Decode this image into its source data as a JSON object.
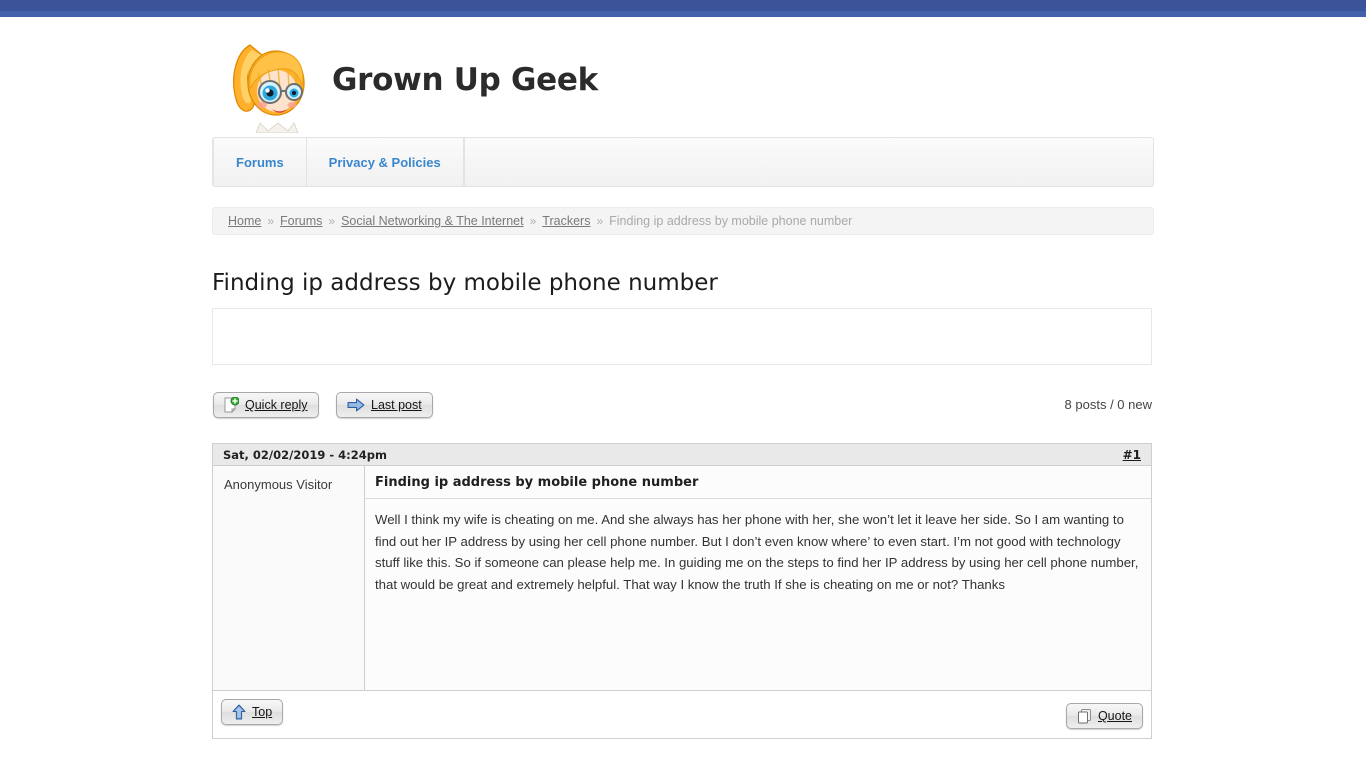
{
  "site": {
    "title": "Grown Up Geek",
    "logo_icon": "geek-girl-avatar-icon"
  },
  "nav": {
    "items": [
      {
        "label": "Forums"
      },
      {
        "label": "Privacy & Policies"
      }
    ]
  },
  "breadcrumb": {
    "separator": "»",
    "items": [
      {
        "label": "Home",
        "link": true
      },
      {
        "label": "Forums",
        "link": true
      },
      {
        "label": "Social Networking & The Internet",
        "link": true
      },
      {
        "label": "Trackers",
        "link": true
      }
    ],
    "current": "Finding ip address by mobile phone number"
  },
  "page": {
    "title": "Finding ip address by mobile phone number"
  },
  "toolbar": {
    "quick_reply_label": "Quick reply",
    "quick_reply_icon": "new-page-plus-icon",
    "last_post_label": "Last post",
    "last_post_icon": "blue-right-arrow-icon",
    "posts_count": "8 posts / 0 new"
  },
  "post": {
    "date": "Sat, 02/02/2019 - 4:24pm",
    "permalink": "#1",
    "author": "Anonymous Visitor",
    "subject": "Finding ip address by mobile phone number",
    "body": "Well I think my wife is cheating on me. And she always has her phone with her, she won’t let it leave her side. So I am wanting to find out her IP address by using her cell phone number. But I don’t even know where’ to even start. I’m not good with technology stuff like this. So if someone can please help me. In guiding me on the steps to find her IP address by using her cell phone number, that would be great and extremely helpful. That way I know the truth If she is cheating on me or not? Thanks",
    "top_label": "Top",
    "top_icon": "blue-up-arrow-icon",
    "quote_label": "Quote",
    "quote_icon": "copy-pages-icon"
  },
  "colors": {
    "topbar_dark": "#3b5499",
    "topbar_light": "#4360ab",
    "nav_link": "#3a87cd",
    "text": "#333333"
  }
}
